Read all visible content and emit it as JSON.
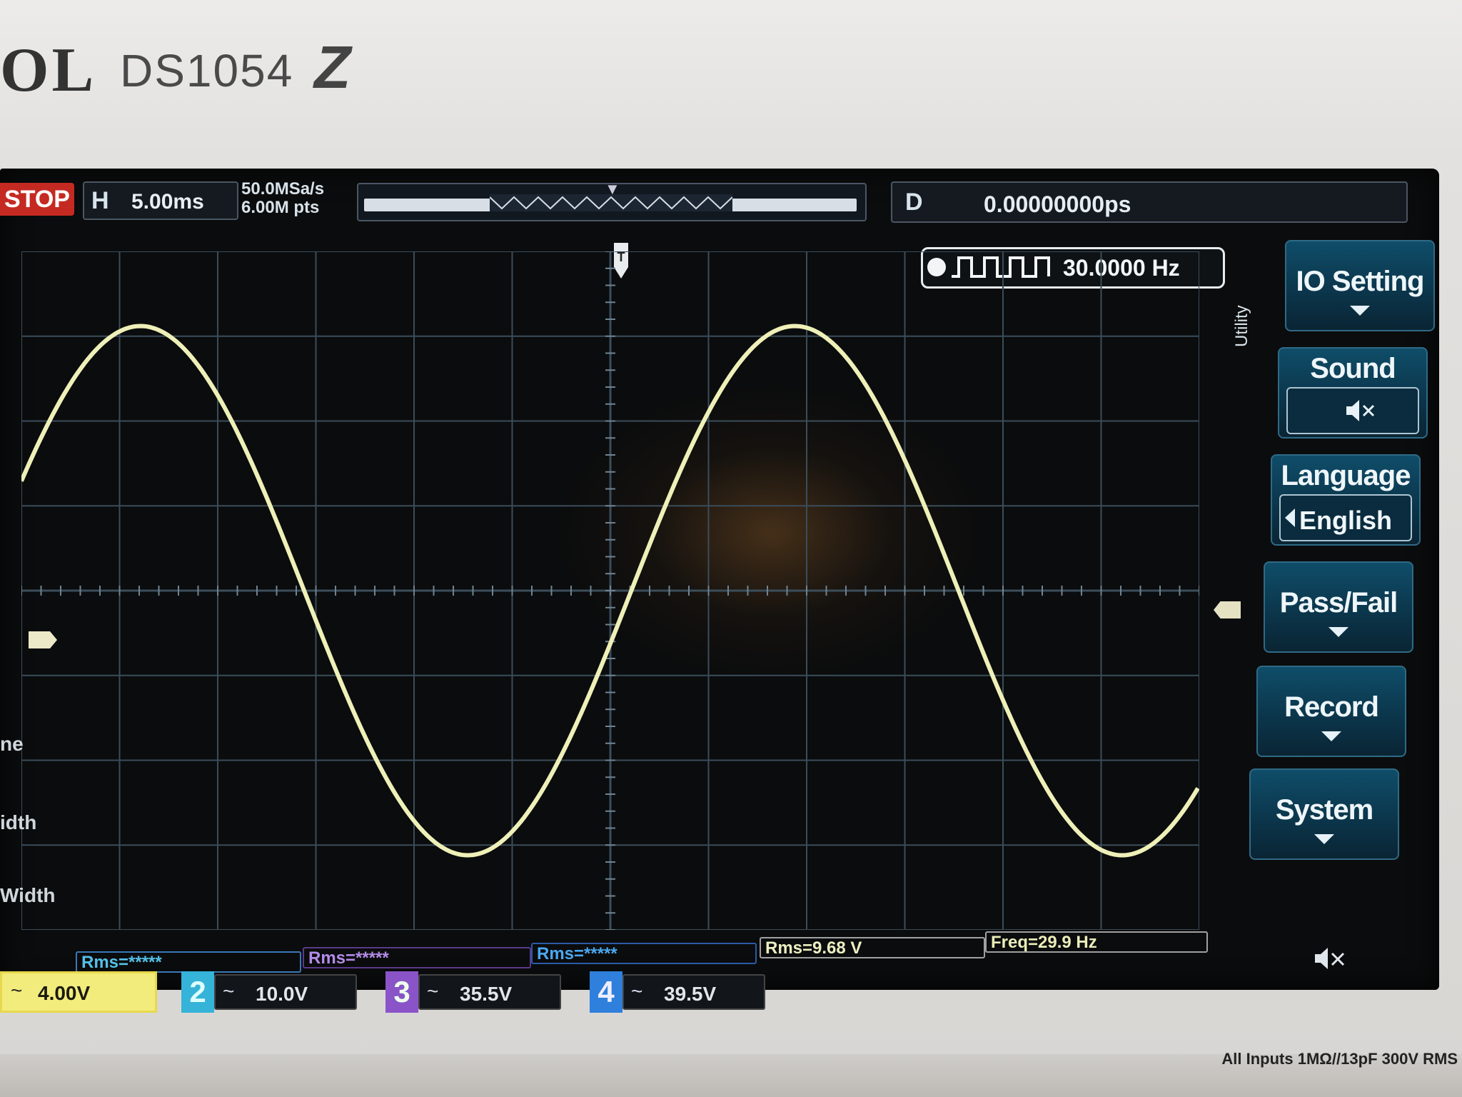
{
  "device": {
    "brand_fragment": "OL",
    "model": "DS1054",
    "model_suffix": "Z",
    "input_spec": "All Inputs 1MΩ//13pF 300V RMS"
  },
  "topbar": {
    "run_state": "STOP",
    "horizontal_label": "H",
    "timebase": "5.00ms",
    "sample_rate": "50.0MSa/s",
    "memory_depth": "6.00M pts",
    "delay_label": "D",
    "delay_value": "0.00000000ps"
  },
  "counter": {
    "frequency": "30.0000 Hz"
  },
  "waveform": {
    "channel": 1,
    "color": "#eef0b8",
    "shape": "sine",
    "frequency_hz": 30.0,
    "timebase_ms_per_div": 5.0,
    "volts_per_div": 4.0
  },
  "measurements": [
    {
      "label": "Rms=*****"
    },
    {
      "label": "Rms=*****"
    },
    {
      "label": "Rms=*****"
    },
    {
      "label": "Rms=9.68 V"
    },
    {
      "label": "Freq=29.9 Hz"
    }
  ],
  "channels": [
    {
      "number": "1",
      "coupling": "~",
      "scale": "4.00V",
      "color": "#f2ec7c"
    },
    {
      "number": "2",
      "coupling": "~",
      "scale": "10.0V",
      "color": "#35b3d8"
    },
    {
      "number": "3",
      "coupling": "~",
      "scale": "35.5V",
      "color": "#8a54c8"
    },
    {
      "number": "4",
      "coupling": "~",
      "scale": "39.5V",
      "color": "#2f7fdc"
    }
  ],
  "menu": {
    "title": "Utility",
    "items": [
      {
        "label": "IO Setting"
      },
      {
        "label": "Sound",
        "value_icon": "mute-icon"
      },
      {
        "label": "Language",
        "value": "English"
      },
      {
        "label": "Pass/Fail"
      },
      {
        "label": "Record"
      },
      {
        "label": "System"
      }
    ]
  },
  "left_labels": {
    "partial_1": "ne",
    "partial_2": "idth",
    "partial_3": "Width"
  }
}
